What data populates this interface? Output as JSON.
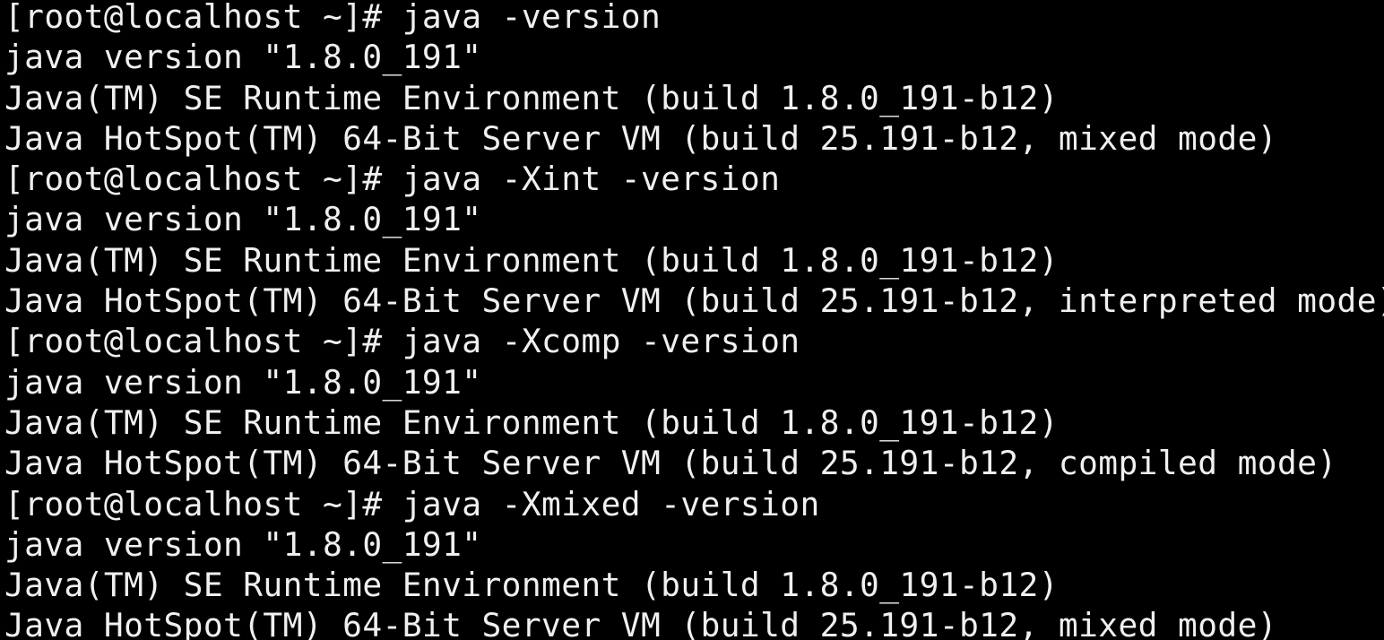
{
  "terminal": {
    "lines": [
      "[root@localhost ~]# java -version",
      "java version \"1.8.0_191\"",
      "Java(TM) SE Runtime Environment (build 1.8.0_191-b12)",
      "Java HotSpot(TM) 64-Bit Server VM (build 25.191-b12, mixed mode)",
      "[root@localhost ~]# java -Xint -version",
      "java version \"1.8.0_191\"",
      "Java(TM) SE Runtime Environment (build 1.8.0_191-b12)",
      "Java HotSpot(TM) 64-Bit Server VM (build 25.191-b12, interpreted mode)",
      "[root@localhost ~]# java -Xcomp -version",
      "java version \"1.8.0_191\"",
      "Java(TM) SE Runtime Environment (build 1.8.0_191-b12)",
      "Java HotSpot(TM) 64-Bit Server VM (build 25.191-b12, compiled mode)",
      "[root@localhost ~]# java -Xmixed -version",
      "java version \"1.8.0_191\"",
      "Java(TM) SE Runtime Environment (build 1.8.0_191-b12)",
      "Java HotSpot(TM) 64-Bit Server VM (build 25.191-b12, mixed mode)"
    ]
  },
  "colors": {
    "background": "#000000",
    "text": "#f0f0f0"
  }
}
